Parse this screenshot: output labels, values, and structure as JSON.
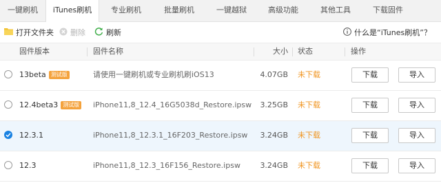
{
  "tabs": [
    {
      "label": "一键刷机",
      "active": false
    },
    {
      "label": "iTunes刷机",
      "active": true
    },
    {
      "label": "专业刷机",
      "active": false
    },
    {
      "label": "批量刷机",
      "active": false
    },
    {
      "label": "一键越狱",
      "active": false
    },
    {
      "label": "高级功能",
      "active": false
    },
    {
      "label": "其他工具",
      "active": false
    },
    {
      "label": "下载固件",
      "active": false
    }
  ],
  "toolbar": {
    "open_folder": "打开文件夹",
    "delete": "删除",
    "refresh": "刷新",
    "help": "什么是“iTunes刷机”？"
  },
  "columns": {
    "version": "固件版本",
    "name": "固件名称",
    "size": "大小",
    "status": "状态",
    "action": "操作"
  },
  "rows": [
    {
      "version": "13beta",
      "badge": "测试版",
      "name": "请使用一键刷机或专业刷机刷iOS13",
      "size": "4.07GB",
      "status": "未下载",
      "download": "下载",
      "import": "导入",
      "selected": false
    },
    {
      "version": "12.4beta3",
      "badge": "测试版",
      "name": "iPhone11,8_12.4_16G5038d_Restore.ipsw",
      "size": "3.25GB",
      "status": "未下载",
      "download": "下载",
      "import": "导入",
      "selected": false
    },
    {
      "version": "12.3.1",
      "badge": "",
      "name": "iPhone11,8_12.3.1_16F203_Restore.ipsw",
      "size": "3.24GB",
      "status": "未下载",
      "download": "下载",
      "import": "导入",
      "selected": true
    },
    {
      "version": "12.3",
      "badge": "",
      "name": "iPhone11,8_12.3_16F156_Restore.ipsw",
      "size": "3.24GB",
      "status": "未下载",
      "download": "下载",
      "import": "导入",
      "selected": false
    }
  ],
  "colors": {
    "accent": "#1a82e2",
    "status": "#f0941f",
    "badge": "#f4a23c"
  }
}
